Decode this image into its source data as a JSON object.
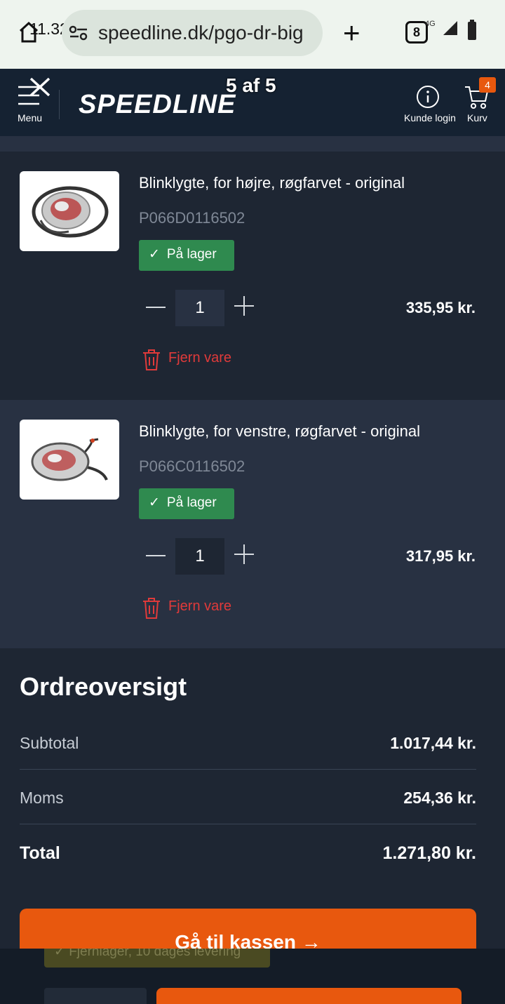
{
  "browser": {
    "time": "11.32",
    "url": "speedline.dk/pgo-dr-big",
    "tab_count": "8",
    "network": "4G"
  },
  "header": {
    "menu_label": "Menu",
    "logo_text": "SPEEDLINE",
    "image_counter": "5 af 5",
    "login_label": "Kunde login",
    "cart_label": "Kurv",
    "cart_count": "4"
  },
  "cart": {
    "items": [
      {
        "name": "Blinklygte, for højre, røgfarvet - original",
        "sku": "P066D0116502",
        "stock": "På lager",
        "quantity": "1",
        "price": "335,95 kr.",
        "remove_label": "Fjern vare"
      },
      {
        "name": "Blinklygte, for venstre, røgfarvet - original",
        "sku": "P066C0116502",
        "stock": "På lager",
        "quantity": "1",
        "price": "317,95 kr.",
        "remove_label": "Fjern vare"
      }
    ]
  },
  "summary": {
    "title": "Ordreoversigt",
    "subtotal_label": "Subtotal",
    "subtotal_value": "1.017,44 kr.",
    "vat_label": "Moms",
    "vat_value": "254,36 kr.",
    "total_label": "Total",
    "total_value": "1.271,80 kr.",
    "checkout_label": "Gå til kassen →"
  },
  "background_page": {
    "stock_badge": "✓ Fjernlager, 10 dages levering"
  },
  "colors": {
    "accent": "#e8580e",
    "stock_green": "#2f8a4f",
    "remove_red": "#e03a3a",
    "panel": "#1e2633",
    "header": "#152232"
  }
}
